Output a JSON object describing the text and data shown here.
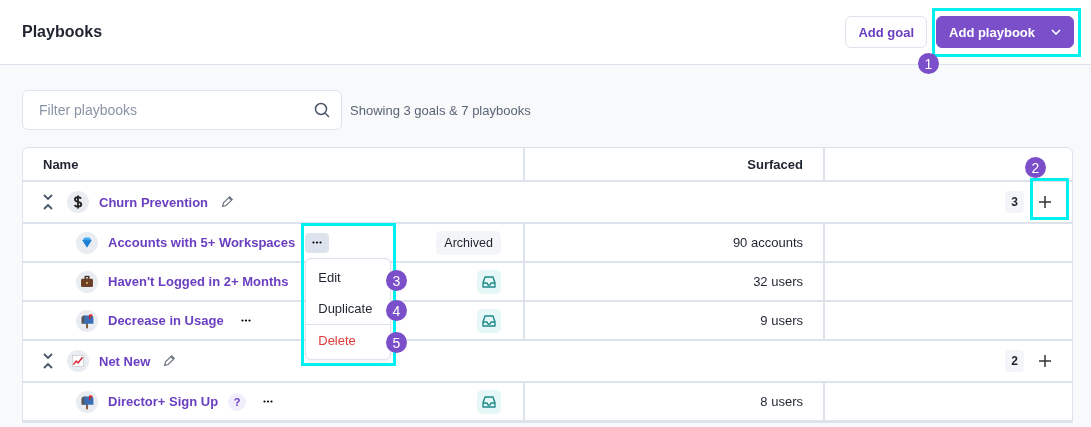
{
  "header": {
    "title": "Playbooks",
    "buttons": [
      {
        "label": "Add goal",
        "kind": "secondary"
      },
      {
        "label": "Add playbook",
        "kind": "primary"
      }
    ]
  },
  "filter": {
    "placeholder": "Filter playbooks"
  },
  "summary": "Showing 3 goals & 7 playbooks",
  "table": {
    "columns": [
      "Name",
      "Surfaced"
    ],
    "rows": [
      {
        "kind": "goal",
        "name": "Churn Prevention",
        "count": "3"
      },
      {
        "kind": "playbook",
        "name": "Accounts with 5+ Workspaces",
        "more": {
          "open": true
        },
        "trailing": {
          "kind": "tag",
          "label": "Archived"
        },
        "surfaced": "90 accounts"
      },
      {
        "kind": "playbook",
        "name": "Haven't Logged in 2+ Months",
        "trailing": {
          "kind": "inbox"
        },
        "surfaced": "32 users"
      },
      {
        "kind": "playbook",
        "name": "Decrease in Usage",
        "more": {
          "open": false
        },
        "trailing": {
          "kind": "inbox"
        },
        "surfaced": "9 users"
      },
      {
        "kind": "goal",
        "name": "Net New",
        "count": "2"
      },
      {
        "kind": "playbook",
        "name": "Director+ Sign Up",
        "help": "?",
        "more": {
          "open": false
        },
        "trailing": {
          "kind": "inbox"
        },
        "surfaced": "8 users"
      }
    ]
  },
  "menu": {
    "items": [
      {
        "label": "Edit",
        "kind": "normal"
      },
      {
        "label": "Duplicate",
        "kind": "normal"
      },
      {
        "label": "Delete",
        "kind": "danger"
      }
    ]
  },
  "annotations": [
    {
      "label": "1"
    },
    {
      "label": "2"
    },
    {
      "label": "3"
    },
    {
      "label": "4"
    },
    {
      "label": "5"
    }
  ]
}
